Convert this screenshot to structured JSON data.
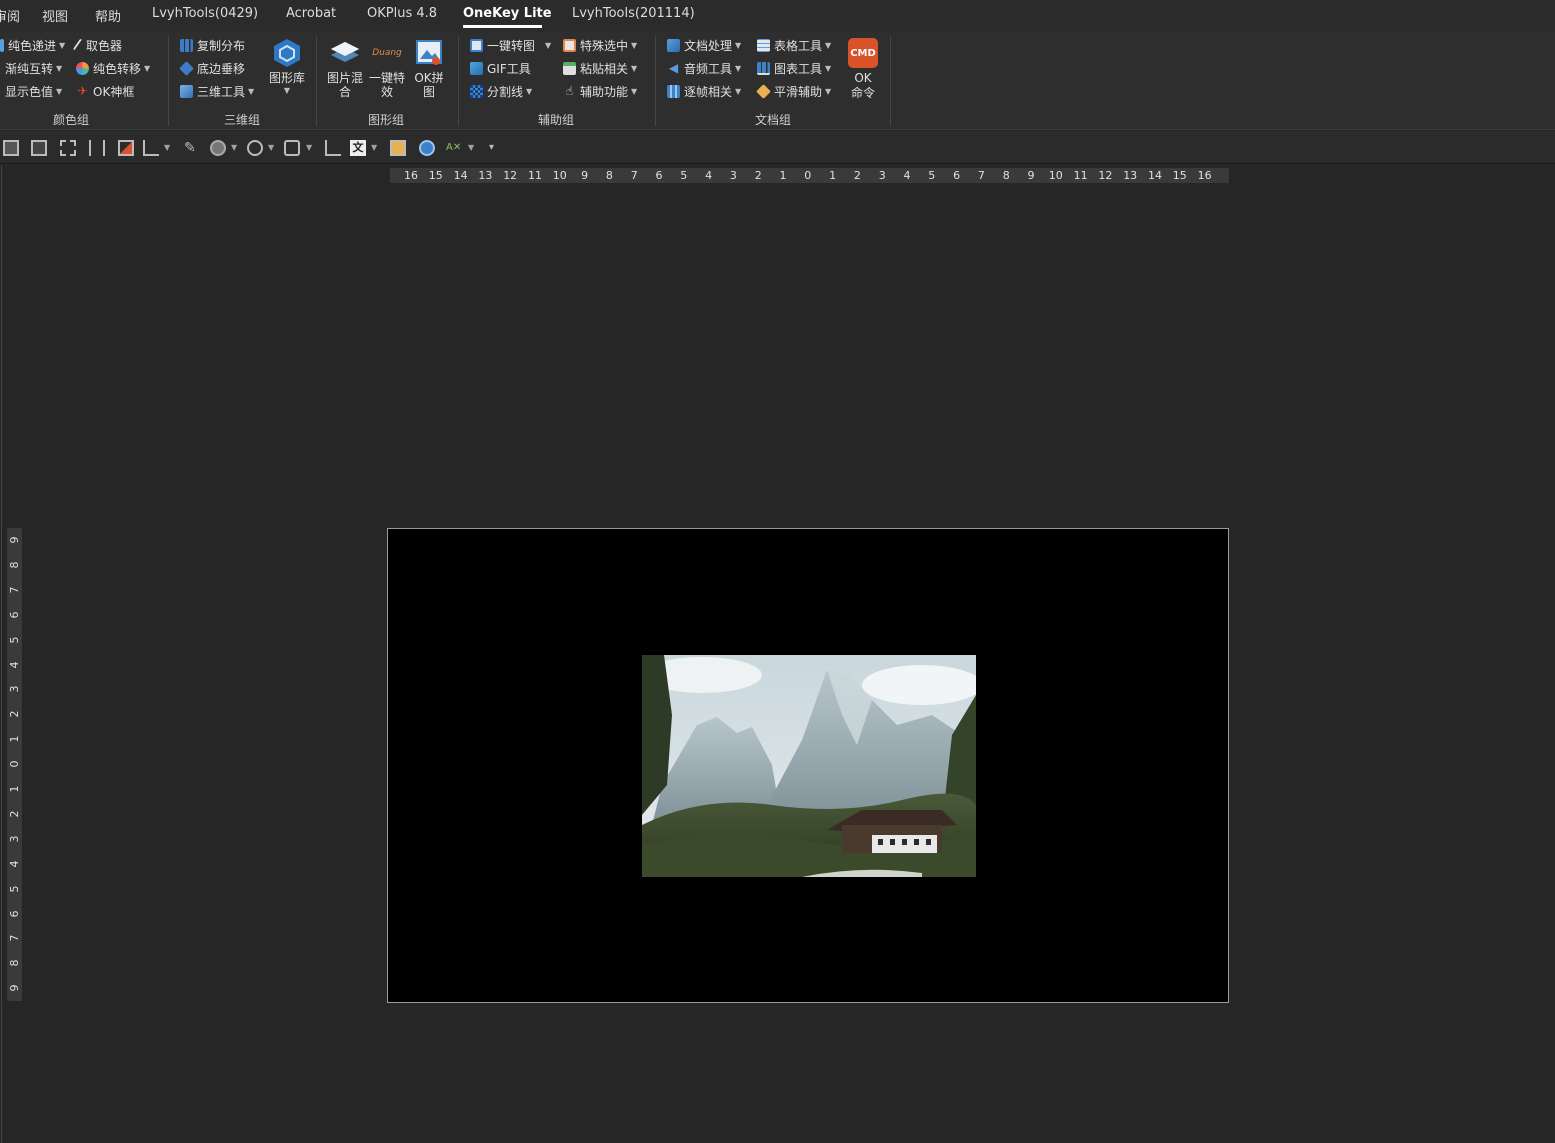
{
  "tabs": [
    {
      "label": "审阅",
      "active": false
    },
    {
      "label": "视图",
      "active": false
    },
    {
      "label": "帮助",
      "active": false
    },
    {
      "label": "LvyhTools(0429)",
      "active": false
    },
    {
      "label": "Acrobat",
      "active": false
    },
    {
      "label": "OKPlus 4.8",
      "active": false
    },
    {
      "label": "OneKey Lite",
      "active": true
    },
    {
      "label": "LvyhTools(201114)",
      "active": false
    }
  ],
  "ribbon": {
    "color_group": {
      "label": "颜色组",
      "items": [
        "纯色递进",
        "渐纯互转",
        "显示色值",
        "取色器",
        "纯色转移",
        "OK神框"
      ]
    },
    "three_d_group": {
      "label": "三维组",
      "items": [
        "复制分布",
        "底边垂移",
        "三维工具"
      ],
      "big": "图形库"
    },
    "shape_group": {
      "label": "图形组",
      "big": [
        "图片混合",
        "一键特效",
        "OK拼图"
      ],
      "duang": "Duang"
    },
    "assist_group": {
      "label": "辅助组",
      "items": [
        "一键转图",
        "GIF工具",
        "分割线",
        "特殊选中",
        "粘贴相关",
        "辅助功能"
      ]
    },
    "doc_group": {
      "label": "文档组",
      "items": [
        "文档处理",
        "音频工具",
        "逐帧相关",
        "表格工具",
        "图表工具",
        "平滑辅助"
      ],
      "big_line1": "OK",
      "big_line2": "命令",
      "cmd_badge": "CMD"
    }
  },
  "ruler": {
    "horizontal": [
      "16",
      "15",
      "14",
      "13",
      "12",
      "11",
      "10",
      "9",
      "8",
      "7",
      "6",
      "5",
      "4",
      "3",
      "2",
      "1",
      "0",
      "1",
      "2",
      "3",
      "4",
      "5",
      "6",
      "7",
      "8",
      "9",
      "10",
      "11",
      "12",
      "13",
      "14",
      "15",
      "16"
    ],
    "vertical": [
      "9",
      "8",
      "7",
      "6",
      "5",
      "4",
      "3",
      "2",
      "1",
      "0",
      "1",
      "2",
      "3",
      "4",
      "5",
      "6",
      "7",
      "8",
      "9"
    ]
  },
  "colors": {
    "accent_orange": "#d9522a",
    "accent_blue": "#3b82c8",
    "slide_bg": "#000000"
  }
}
